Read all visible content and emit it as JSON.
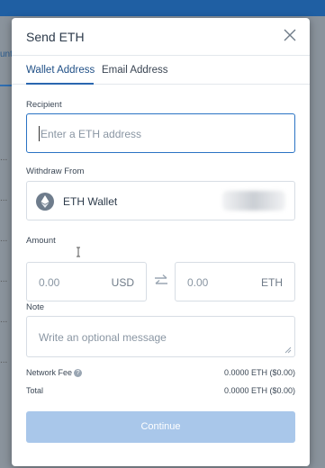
{
  "background": {
    "tab_fragment": "unt",
    "dots": [
      "...",
      "...",
      "...",
      "...",
      "...",
      "..."
    ]
  },
  "modal": {
    "title": "Send ETH",
    "close_icon": "close-icon",
    "tabs": [
      {
        "label": "Wallet Address",
        "active": true
      },
      {
        "label": "Email Address",
        "active": false
      }
    ],
    "recipient": {
      "label": "Recipient",
      "placeholder": "Enter a ETH address",
      "value": ""
    },
    "withdraw": {
      "label": "Withdraw From",
      "wallet_name": "ETH Wallet",
      "wallet_icon": "ethereum-icon"
    },
    "amount": {
      "label": "Amount",
      "fiat_value": "0.00",
      "fiat_unit": "USD",
      "crypto_value": "0.00",
      "crypto_unit": "ETH",
      "swap_icon": "swap-arrows-icon"
    },
    "note": {
      "label": "Note",
      "placeholder": "Write an optional message"
    },
    "network_fee": {
      "label": "Network Fee",
      "value": "0.0000 ETH ($0.00)",
      "info_icon": "info-icon"
    },
    "total": {
      "label": "Total",
      "value": "0.0000 ETH ($0.00)"
    },
    "continue_label": "Continue"
  },
  "colors": {
    "accent": "#2a67b0",
    "button_disabled": "#a9c7ea",
    "focus_border": "#2a73c4"
  }
}
